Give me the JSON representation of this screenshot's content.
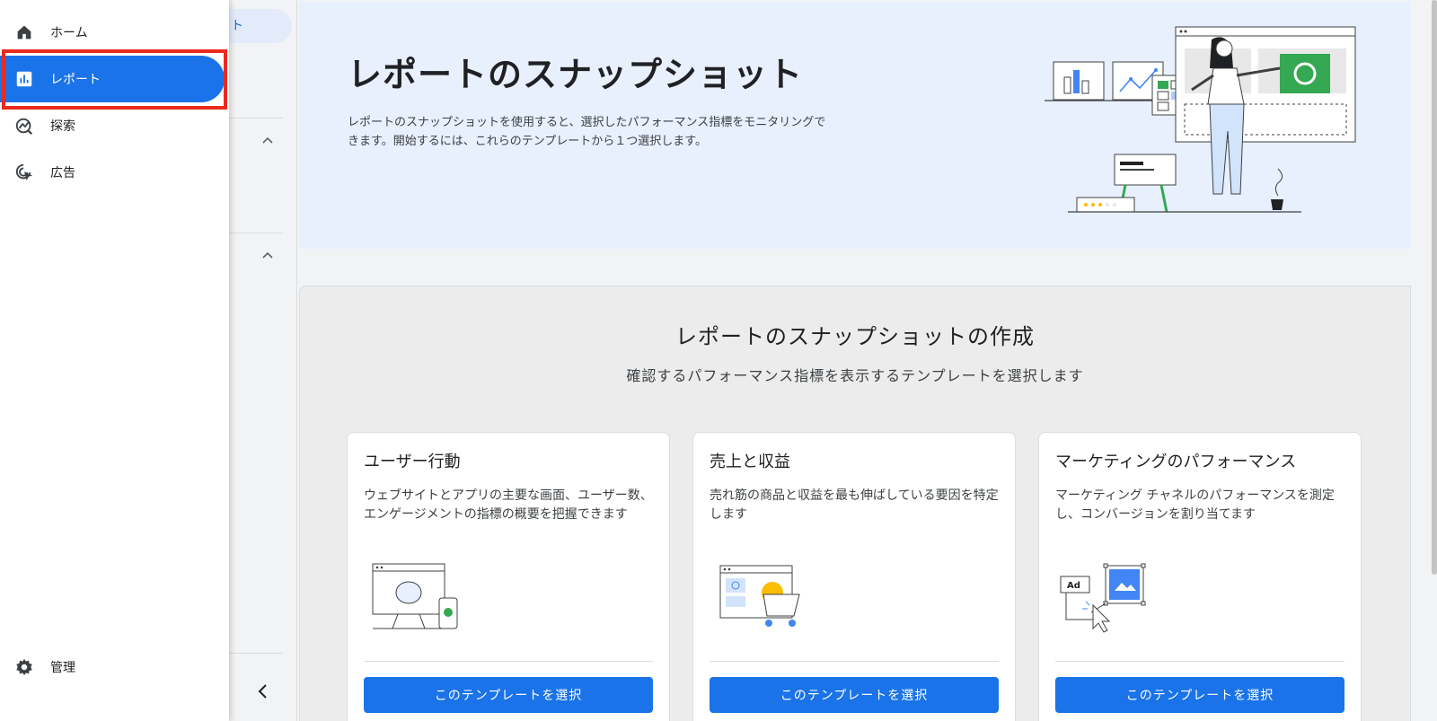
{
  "drawer": {
    "items": [
      {
        "label": "ホーム",
        "icon": "home-icon"
      },
      {
        "label": "レポート",
        "icon": "bar-chart-icon",
        "active": true
      },
      {
        "label": "探索",
        "icon": "explore-icon"
      },
      {
        "label": "広告",
        "icon": "advertising-icon"
      }
    ],
    "admin_label": "管理",
    "admin_icon": "gear-icon"
  },
  "subnav": {
    "active_fragment": "ト"
  },
  "hero": {
    "title": "レポートのスナップショット",
    "description": "レポートのスナップショットを使用すると、選択したパフォーマンス指標をモニタリングできます。開始するには、これらのテンプレートから１つ選択します。"
  },
  "templates": {
    "title": "レポートのスナップショットの作成",
    "subtitle": "確認するパフォーマンス指標を表示するテンプレートを選択します",
    "cards": [
      {
        "title": "ユーザー行動",
        "description": "ウェブサイトとアプリの主要な画面、ユーザー数、エンゲージメントの指標の概要を把握できます",
        "button": "このテンプレートを選択"
      },
      {
        "title": "売上と収益",
        "description": "売れ筋の商品と収益を最も伸ばしている要因を特定します",
        "button": "このテンプレートを選択"
      },
      {
        "title": "マーケティングのパフォーマンス",
        "description": "マーケティング チャネルのパフォーマンスを測定し、コンバージョンを割り当てます",
        "button": "このテンプレートを選択"
      }
    ],
    "ad_badge": "Ad"
  },
  "colors": {
    "accent": "#1a73e8",
    "highlight": "#ea2a1e",
    "hero_bg": "#e8f0fe",
    "green": "#34a853",
    "yellow": "#fbbc04"
  }
}
